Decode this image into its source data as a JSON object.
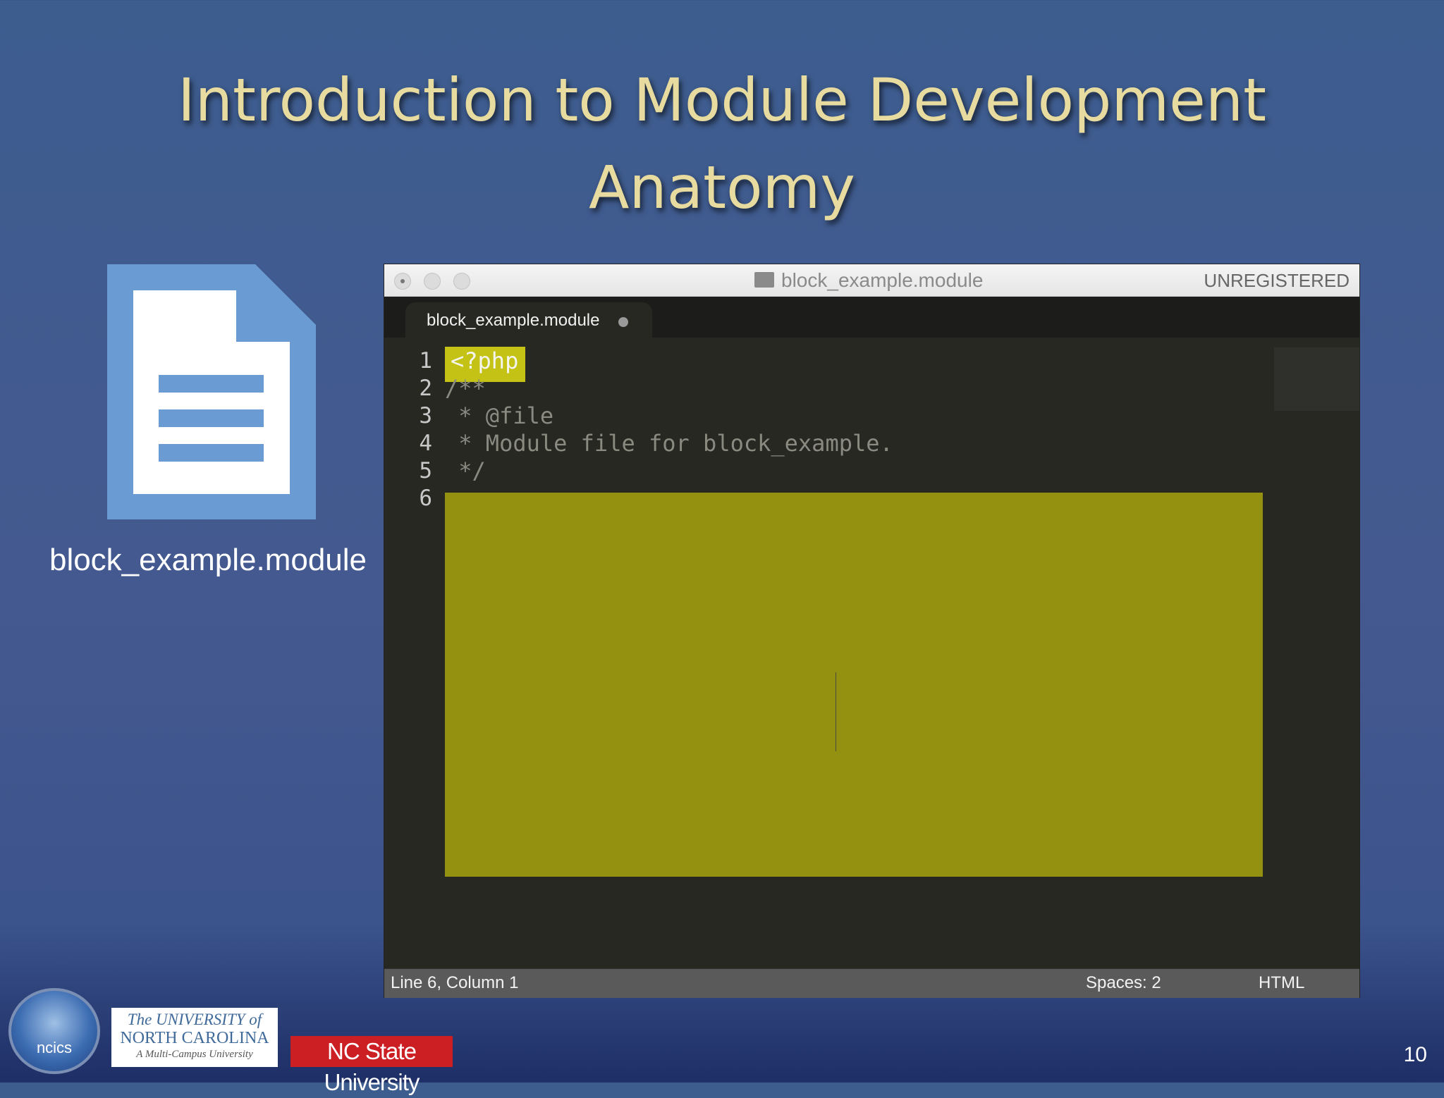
{
  "slide": {
    "title_line1": "Introduction to Module Development",
    "title_line2": "Anatomy",
    "file_caption": "block_example.module",
    "page_number": "10"
  },
  "editor": {
    "window_title": "block_example.module",
    "license_status": "UNREGISTERED",
    "tab_label": "block_example.module",
    "line_numbers": [
      "1",
      "2",
      "3",
      "4",
      "5",
      "6"
    ],
    "code_lines": [
      "<?php",
      "/**",
      " * @file",
      " * Module file for block_example.",
      " */",
      ""
    ],
    "status": {
      "position": "Line 6, Column 1",
      "indentation": "Spaces: 2",
      "syntax": "HTML"
    }
  },
  "logos": {
    "ncics": "ncics",
    "unc_line1": "The UNIVERSITY of",
    "unc_line2": "NORTH CAROLINA",
    "unc_line3": "A Multi-Campus University",
    "ncsu": "NC State University"
  },
  "colors": {
    "title_gold": "#e7dba0",
    "highlight_yellow": "#c3c215",
    "highlight_olive": "#949010",
    "doc_icon_blue": "#6a9bd3",
    "ncsu_red": "#cc1f24"
  }
}
